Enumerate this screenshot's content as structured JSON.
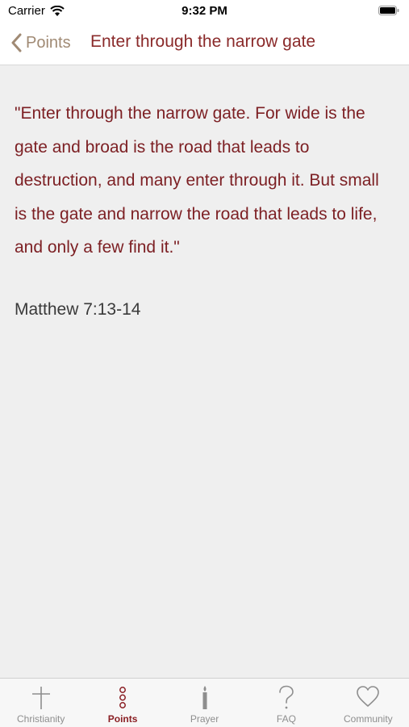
{
  "status_bar": {
    "carrier": "Carrier",
    "time": "9:32 PM"
  },
  "nav": {
    "back_label": "Points",
    "title": "Enter through the narrow gate"
  },
  "content": {
    "quote": "\"Enter through the narrow gate.  For wide is the gate and broad is the road that leads to destruction, and many enter through it.  But small is the gate and narrow the road that leads to life, and only a few find it.\"",
    "reference": "Matthew 7:13-14"
  },
  "tabs": [
    {
      "label": "Christianity",
      "icon": "cross-icon",
      "active": false
    },
    {
      "label": "Points",
      "icon": "points-icon",
      "active": true
    },
    {
      "label": "Prayer",
      "icon": "candle-icon",
      "active": false
    },
    {
      "label": "FAQ",
      "icon": "question-icon",
      "active": false
    },
    {
      "label": "Community",
      "icon": "heart-icon",
      "active": false
    }
  ],
  "colors": {
    "accent": "#8a1f24",
    "back_label": "#a08a74",
    "background": "#efefef"
  }
}
